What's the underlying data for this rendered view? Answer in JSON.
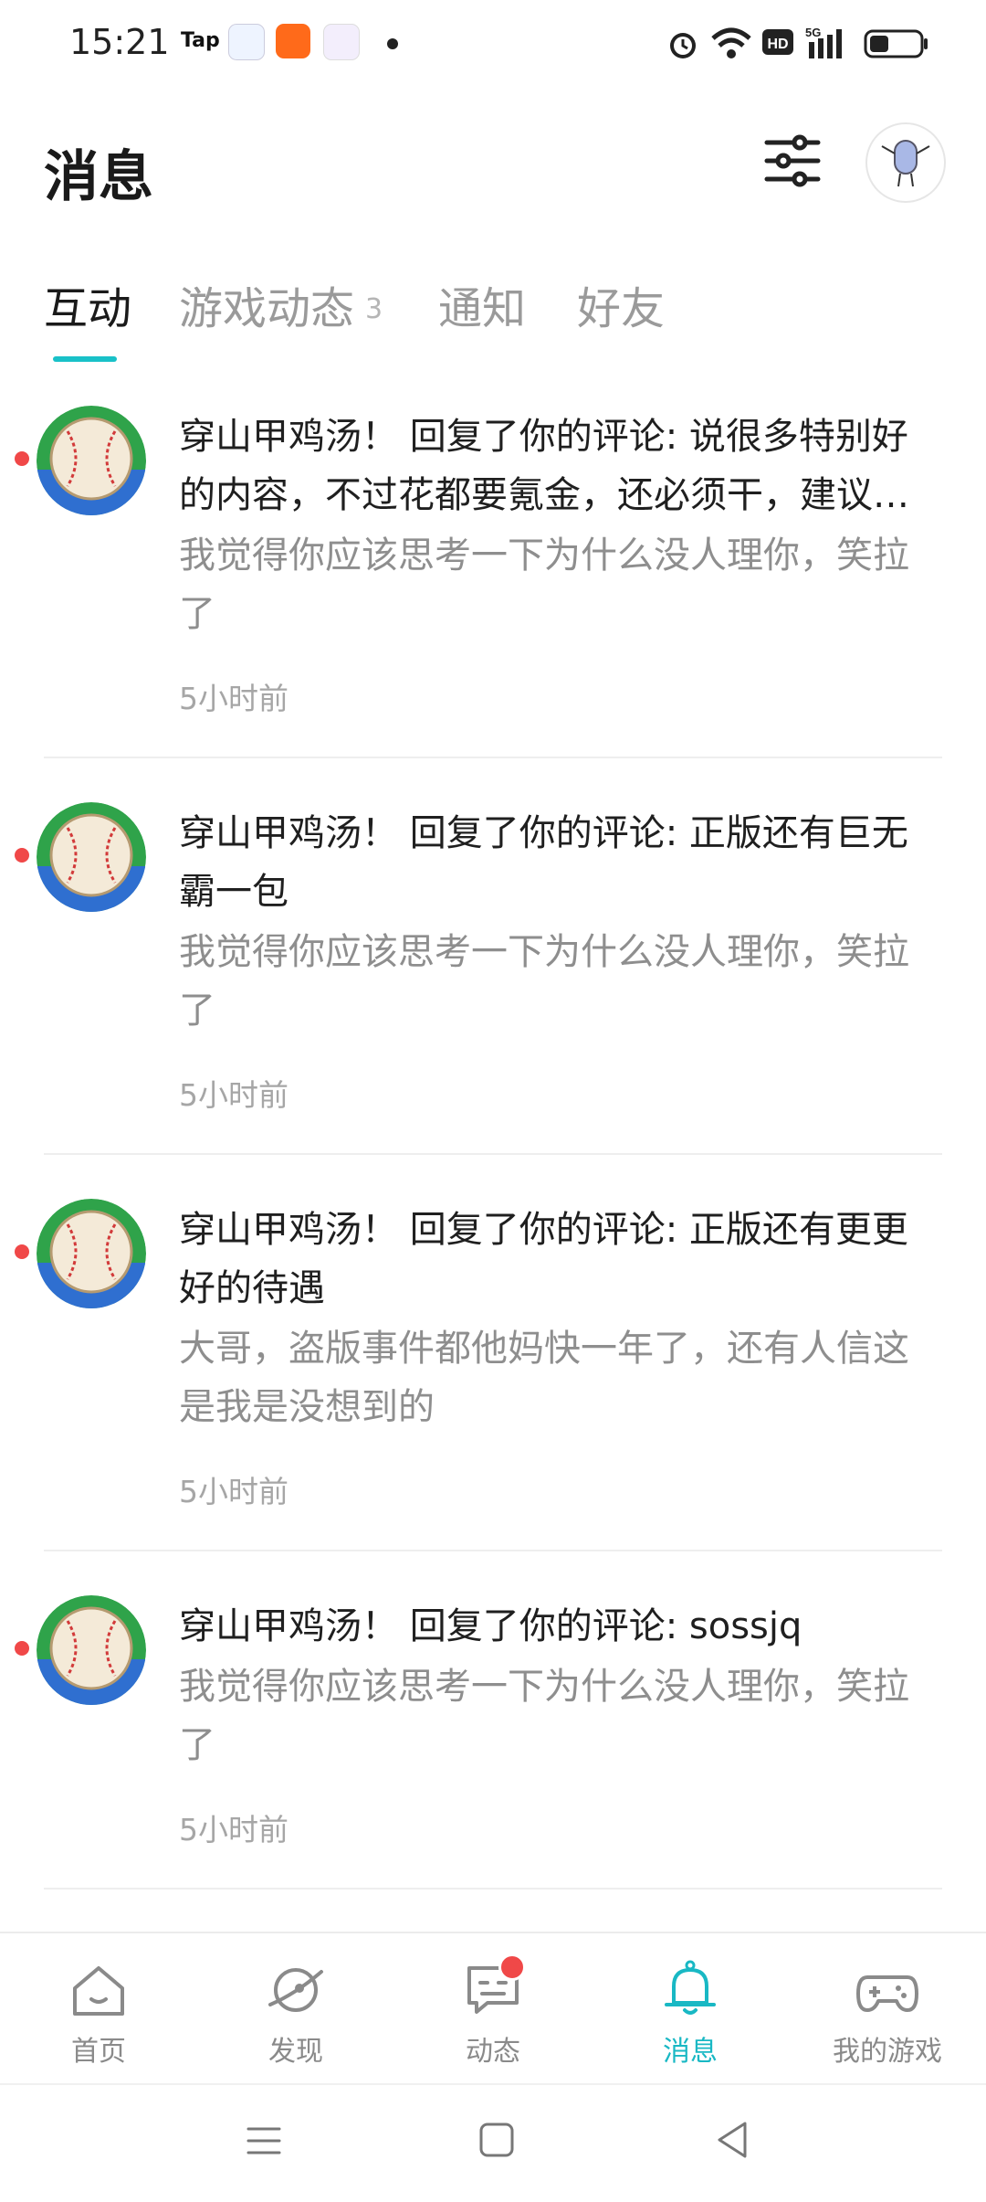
{
  "status": {
    "time": "15:21",
    "tap_label": "Tap"
  },
  "header": {
    "title": "消息"
  },
  "tabs": [
    {
      "label": "互动",
      "badge": ""
    },
    {
      "label": "游戏动态",
      "badge": "3"
    },
    {
      "label": "通知",
      "badge": ""
    },
    {
      "label": "好友",
      "badge": ""
    }
  ],
  "messages": [
    {
      "title": "穿山甲鸡汤！ 回复了你的评论: 说很多特别好的内容，不过花都要氪金，还必须干，建议…",
      "body": "我觉得你应该思考一下为什么没人理你，笑拉了",
      "time": "5小时前"
    },
    {
      "title": "穿山甲鸡汤！ 回复了你的评论: 正版还有巨无霸一包",
      "body": "我觉得你应该思考一下为什么没人理你，笑拉了",
      "time": "5小时前"
    },
    {
      "title": "穿山甲鸡汤！ 回复了你的评论: 正版还有更更好的待遇",
      "body": "大哥，盗版事件都他妈快一年了，还有人信这是我是没想到的",
      "time": "5小时前"
    },
    {
      "title": "穿山甲鸡汤！ 回复了你的评论: sossjq",
      "body": "我觉得你应该思考一下为什么没人理你，笑拉了",
      "time": "5小时前"
    }
  ],
  "bottom_nav": [
    {
      "label": "首页",
      "icon": "home-icon"
    },
    {
      "label": "发现",
      "icon": "discover-icon"
    },
    {
      "label": "动态",
      "icon": "feed-icon"
    },
    {
      "label": "消息",
      "icon": "bell-icon"
    },
    {
      "label": "我的游戏",
      "icon": "gamepad-icon"
    }
  ],
  "colors": {
    "accent": "#19c1c8",
    "unread": "#f04848"
  }
}
